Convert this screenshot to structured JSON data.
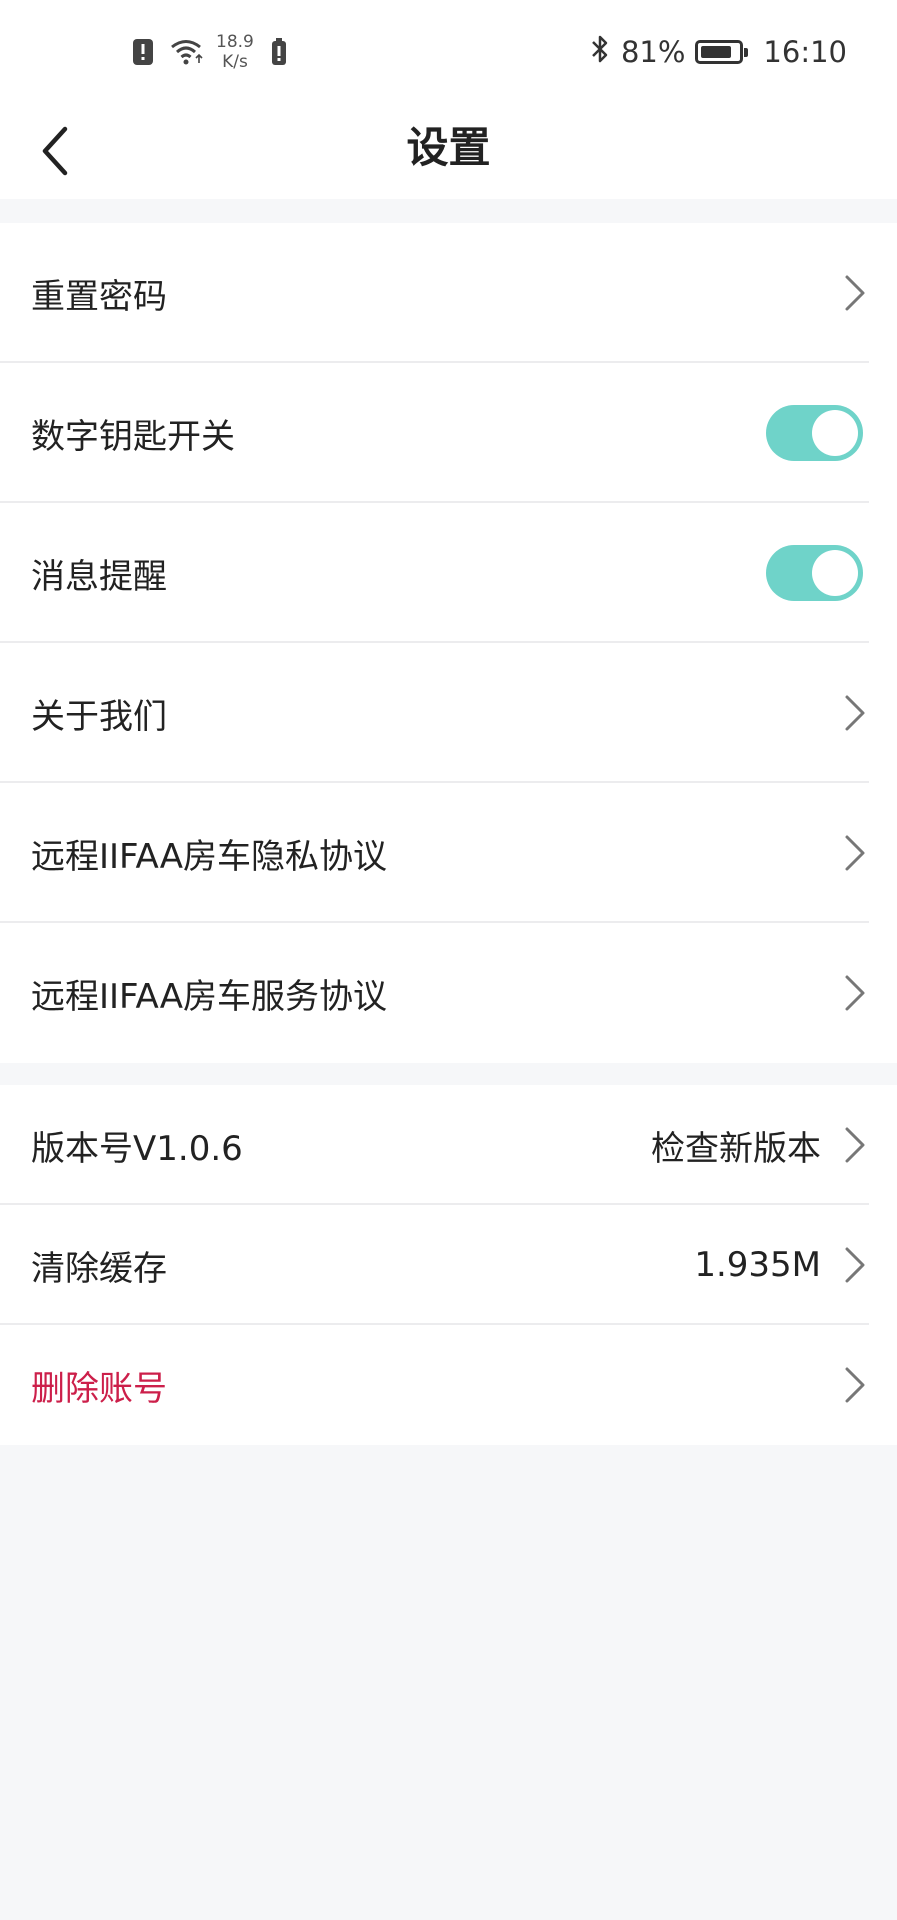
{
  "status_bar": {
    "net_speed_value": "18.9",
    "net_speed_unit": "K/s",
    "battery_percent": "81%",
    "battery_level": 0.81,
    "time": "16:10"
  },
  "navbar": {
    "title": "设置"
  },
  "group1": {
    "items": [
      {
        "label": "重置密码",
        "type": "chevron"
      },
      {
        "label": "数字钥匙开关",
        "type": "toggle",
        "on": true
      },
      {
        "label": "消息提醒",
        "type": "toggle",
        "on": true
      },
      {
        "label": "关于我们",
        "type": "chevron"
      },
      {
        "label": "远程IIFAA房车隐私协议",
        "type": "chevron"
      },
      {
        "label": "远程IIFAA房车服务协议",
        "type": "chevron"
      }
    ]
  },
  "group2": {
    "items": [
      {
        "label": "版本号V1.0.6",
        "value": "检查新版本",
        "type": "chevron"
      },
      {
        "label": "清除缓存",
        "value": "1.935M",
        "type": "chevron"
      },
      {
        "label": "删除账号",
        "type": "chevron",
        "danger": true
      }
    ]
  },
  "colors": {
    "toggle_on": "#6fd3c9",
    "danger": "#cc1f4a",
    "background": "#f6f7f9"
  }
}
